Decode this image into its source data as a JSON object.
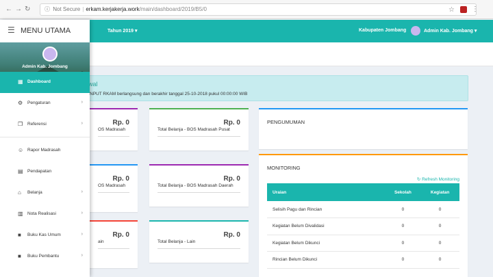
{
  "browser": {
    "not_secure": "Not Secure",
    "host": "erkam.kerjakerja.work",
    "path": "/main/dashboard/2019/B5/0"
  },
  "topbar": {
    "year": "Tahun 2019 ▾",
    "kabupaten": "Kabupaten Jombang",
    "user": "Admin Kab. Jombang ▾"
  },
  "sidebar": {
    "menu_title": "MENU UTAMA",
    "profile_name": "Admin Kab. Jombang",
    "items": [
      {
        "label": "Dashboard",
        "icon": "dashboard-icon",
        "active": true,
        "chevron": false
      },
      {
        "label": "Pengaturan",
        "icon": "gear-icon",
        "active": false,
        "chevron": true
      },
      {
        "label": "Referensi",
        "icon": "copy-icon",
        "active": false,
        "chevron": true
      },
      {
        "label": "Rapor Madrasah",
        "icon": "user-plus-icon",
        "active": false,
        "chevron": false
      },
      {
        "label": "Pendapatan",
        "icon": "calculator-icon",
        "active": false,
        "chevron": false
      },
      {
        "label": "Belanja",
        "icon": "cart-icon",
        "active": false,
        "chevron": true
      },
      {
        "label": "Nota Realisasi",
        "icon": "calendar-icon",
        "active": false,
        "chevron": true
      },
      {
        "label": "Buku Kas Umum",
        "icon": "book-icon",
        "active": false,
        "chevron": true
      },
      {
        "label": "Buku Pembantu",
        "icon": "book-icon",
        "active": false,
        "chevron": true
      }
    ],
    "chevron": "›"
  },
  "alert": {
    "title": "wal",
    "message": "NPUT RKAM berlangsung dan berakhir tanggal 25-10-2018 pukul 00:00:00 WIB"
  },
  "boxes": [
    {
      "amount": "Rp. 0",
      "label": "OS Madrasah",
      "color": "#9c27b0"
    },
    {
      "amount": "Rp. 0",
      "label": "Total Belanja - BOS Madrasah Pusat",
      "color": "#4caf50"
    },
    {
      "amount": "Rp. 0",
      "label": "OS Madrasah",
      "color": "#2196f3"
    },
    {
      "amount": "Rp. 0",
      "label": "Total Belanja - BOS Madrasah Daerah",
      "color": "#9c27b0"
    },
    {
      "amount": "Rp. 0",
      "label": "ain",
      "color": "#f44336"
    },
    {
      "amount": "Rp. 0",
      "label": "Total Belanja - Lain",
      "color": "#1ab5ad"
    }
  ],
  "pengumuman": {
    "title": "PENGUMUMAN",
    "color": "#2196f3"
  },
  "monitoring": {
    "title": "MONITORING",
    "refresh": "↻ Refresh Monitoring",
    "color": "#ff9800",
    "headers": [
      "Uraian",
      "Sekolah",
      "Kegiatan"
    ],
    "rows": [
      [
        "Selisih Pagu dan Rincian",
        "0",
        "0"
      ],
      [
        "Kegiatan Belum Divalidasi",
        "0",
        "0"
      ],
      [
        "Kegiatan Belum Dikunci",
        "0",
        "0"
      ],
      [
        "Rincian Belum Dikunci",
        "0",
        "0"
      ]
    ]
  },
  "colors": {
    "accent": "#1ab5ad"
  }
}
